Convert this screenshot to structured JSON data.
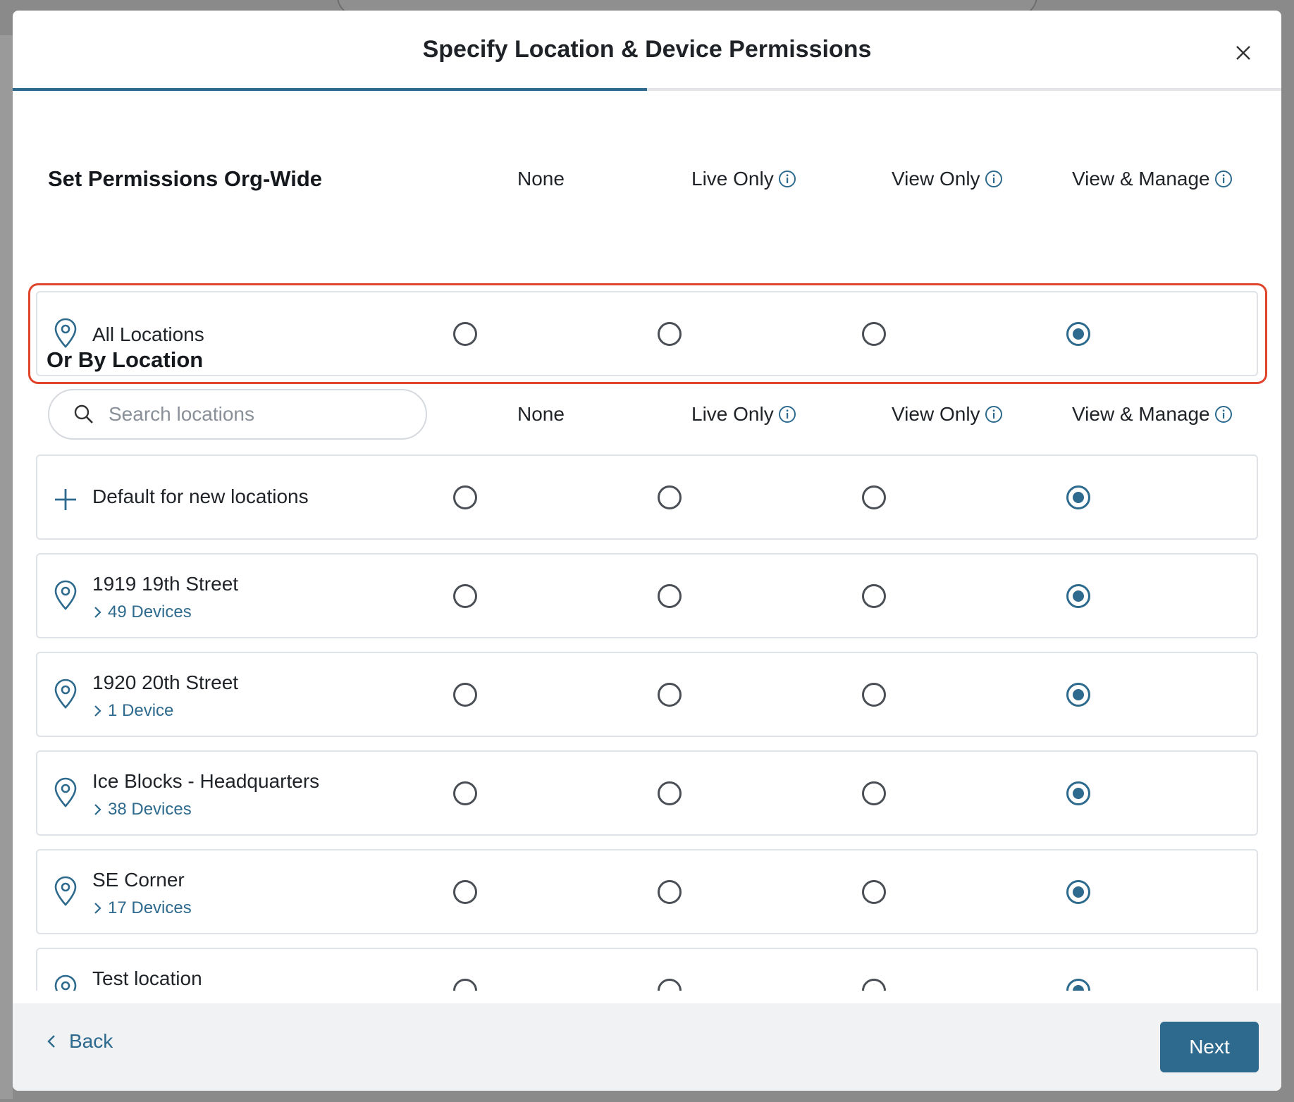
{
  "modal": {
    "title": "Specify Location & Device Permissions",
    "progress_fraction": 0.5
  },
  "org_wide": {
    "heading": "Set Permissions Org-Wide",
    "columns": [
      "None",
      "Live Only",
      "View Only",
      "View & Manage"
    ],
    "row": {
      "label": "All Locations",
      "selected": "View & Manage"
    }
  },
  "by_location": {
    "heading": "Or By Location",
    "search": {
      "placeholder": "Search locations",
      "value": ""
    },
    "columns": [
      "None",
      "Live Only",
      "View Only",
      "View & Manage"
    ],
    "rows": [
      {
        "label": "Default for new locations",
        "icon": "plus-icon",
        "devices": "",
        "selected": "View & Manage"
      },
      {
        "label": "1919 19th Street",
        "icon": "location-pin-icon",
        "devices": "49 Devices",
        "selected": "View & Manage"
      },
      {
        "label": "1920 20th Street",
        "icon": "location-pin-icon",
        "devices": "1 Device",
        "selected": "View & Manage"
      },
      {
        "label": "Ice Blocks - Headquarters",
        "icon": "location-pin-icon",
        "devices": "38 Devices",
        "selected": "View & Manage"
      },
      {
        "label": "SE Corner",
        "icon": "location-pin-icon",
        "devices": "17 Devices",
        "selected": "View & Manage"
      },
      {
        "label": "Test location",
        "icon": "location-pin-icon",
        "devices": "",
        "selected": "View & Manage"
      }
    ]
  },
  "footer": {
    "back_label": "Back",
    "next_label": "Next"
  },
  "colors": {
    "accent": "#2d6a8e",
    "highlight": "#e0452b",
    "footer_bg": "#f1f2f3"
  }
}
